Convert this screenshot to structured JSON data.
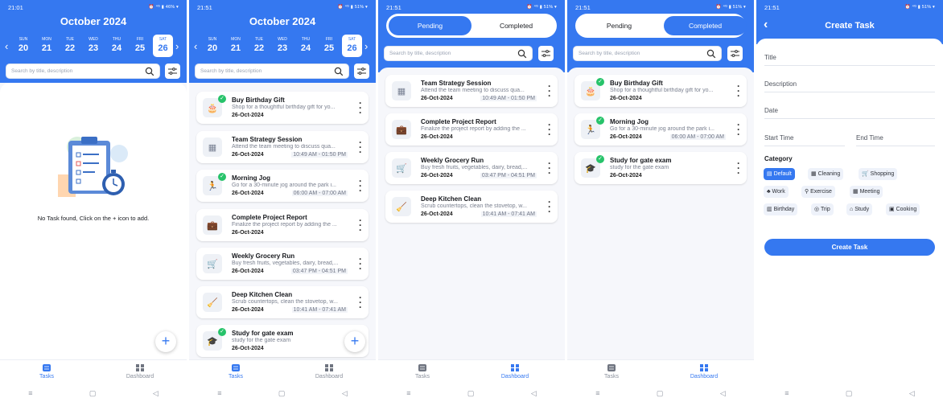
{
  "colors": {
    "primary": "#3578f0",
    "success": "#27c36a"
  },
  "status": {
    "time_a": "21:01",
    "time_b": "21:51",
    "icons_a": "⏰ ⁴ᴳ ▮ 46% ▾",
    "icons_b": "⏰ ⁴ᴳ ▮ 51% ▾"
  },
  "calendar": {
    "month": "October 2024",
    "days": [
      {
        "name": "SUN",
        "num": "20"
      },
      {
        "name": "MON",
        "num": "21"
      },
      {
        "name": "TUE",
        "num": "22"
      },
      {
        "name": "WED",
        "num": "23"
      },
      {
        "name": "THU",
        "num": "24"
      },
      {
        "name": "FRI",
        "num": "25"
      },
      {
        "name": "SAT",
        "num": "26"
      }
    ]
  },
  "search": {
    "placeholder": "Search by title, description"
  },
  "empty": {
    "message": "No Task found, Click on the + icon to add."
  },
  "tabs": {
    "tasks": "Tasks",
    "dashboard": "Dashboard"
  },
  "toggle": {
    "pending": "Pending",
    "completed": "Completed"
  },
  "tasks": {
    "gift": {
      "title": "Buy Birthday Gift",
      "desc": "Shop for a thoughtful birthday gift for yo...",
      "date": "26-Oct-2024",
      "time": "",
      "icon": "gift-icon"
    },
    "strategy": {
      "title": "Team Strategy Session",
      "desc": "Attend the team meeting to discuss qua...",
      "date": "26-Oct-2024",
      "time": "10:49 AM - 01:50 PM",
      "icon": "meeting-icon"
    },
    "jog": {
      "title": "Morning Jog",
      "desc": "Go for a 30-minute jog around the park i...",
      "date": "26-Oct-2024",
      "time": "06:00 AM - 07:00 AM",
      "icon": "runner-icon"
    },
    "report": {
      "title": "Complete Project Report",
      "desc": "Finalize the project report by adding the ...",
      "date": "26-Oct-2024",
      "time": "",
      "icon": "work-icon"
    },
    "grocery": {
      "title": "Weekly Grocery Run",
      "desc": "Buy fresh fruits, vegetables, dairy, bread,...",
      "date": "26-Oct-2024",
      "time": "03:47 PM - 04:51 PM",
      "icon": "cart-icon"
    },
    "kitchen": {
      "title": "Deep Kitchen Clean",
      "desc": "Scrub countertops, clean the stovetop, w...",
      "date": "26-Oct-2024",
      "time": "10:41 AM - 07:41 AM",
      "icon": "cleaning-icon"
    },
    "study": {
      "title": "Study for gate exam",
      "desc": "study for the gate exam",
      "date": "26-Oct-2024",
      "time": "",
      "icon": "graduation-cap-icon"
    }
  },
  "create": {
    "header": "Create Task",
    "title": "Title",
    "description": "Description",
    "date": "Date",
    "start": "Start Time",
    "end": "End Time",
    "category_label": "Category",
    "button": "Create Task",
    "categories": [
      {
        "label": "Default",
        "icon": "default-icon"
      },
      {
        "label": "Cleaning",
        "icon": "cleaning-icon"
      },
      {
        "label": "Shopping",
        "icon": "cart-icon"
      },
      {
        "label": "Work",
        "icon": "work-icon"
      },
      {
        "label": "Exercise",
        "icon": "runner-icon"
      },
      {
        "label": "Meeting",
        "icon": "meeting-icon"
      },
      {
        "label": "Birthday",
        "icon": "gift-icon"
      },
      {
        "label": "Trip",
        "icon": "trip-icon"
      },
      {
        "label": "Study",
        "icon": "graduation-cap-icon"
      },
      {
        "label": "Cooking",
        "icon": "cooking-icon"
      }
    ],
    "selected_category": "Default"
  },
  "sysnav": {
    "menu": "≡",
    "home": "▢",
    "back": "◁"
  }
}
